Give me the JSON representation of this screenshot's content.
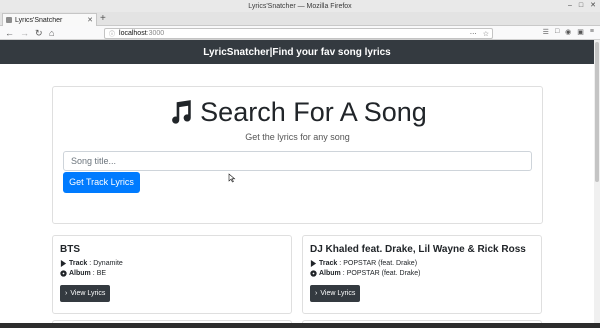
{
  "window": {
    "title": "Lyrics'Snatcher — Mozilla Firefox",
    "controls": [
      "–",
      "□",
      "✕"
    ]
  },
  "browser": {
    "tab_title": "Lyrics'Snatcher",
    "tab_close": "✕",
    "new_tab": "+",
    "url_host": "localhost",
    "url_port": ":3000",
    "url_icons": [
      "⋯",
      "☆"
    ]
  },
  "app": {
    "brand": "LyricSnatcher|Find your fav song lyrics"
  },
  "search": {
    "title": "Search For A Song",
    "subtitle": "Get the lyrics for any song",
    "placeholder": "Song title...",
    "button_label": "Get Track Lyrics"
  },
  "results": [
    {
      "artist": "BTS",
      "track_label": "Track",
      "track": "Dynamite",
      "album_label": "Album",
      "album": "BE",
      "button_label": "View Lyrics"
    },
    {
      "artist": "DJ Khaled feat. Drake, Lil Wayne & Rick Ross",
      "track_label": "Track",
      "track": "POPSTAR (feat. Drake)",
      "album_label": "Album",
      "album": "POPSTAR (feat. Drake)",
      "button_label": "View Lyrics"
    }
  ],
  "colors": {
    "header_bg": "#343a40",
    "primary": "#007bff",
    "text": "#212529"
  },
  "icons": {
    "title_icon": "music-note-icon",
    "track_icon": "play-icon",
    "album_icon": "compact-disc-icon",
    "button_icon": "chevron-right-icon"
  }
}
